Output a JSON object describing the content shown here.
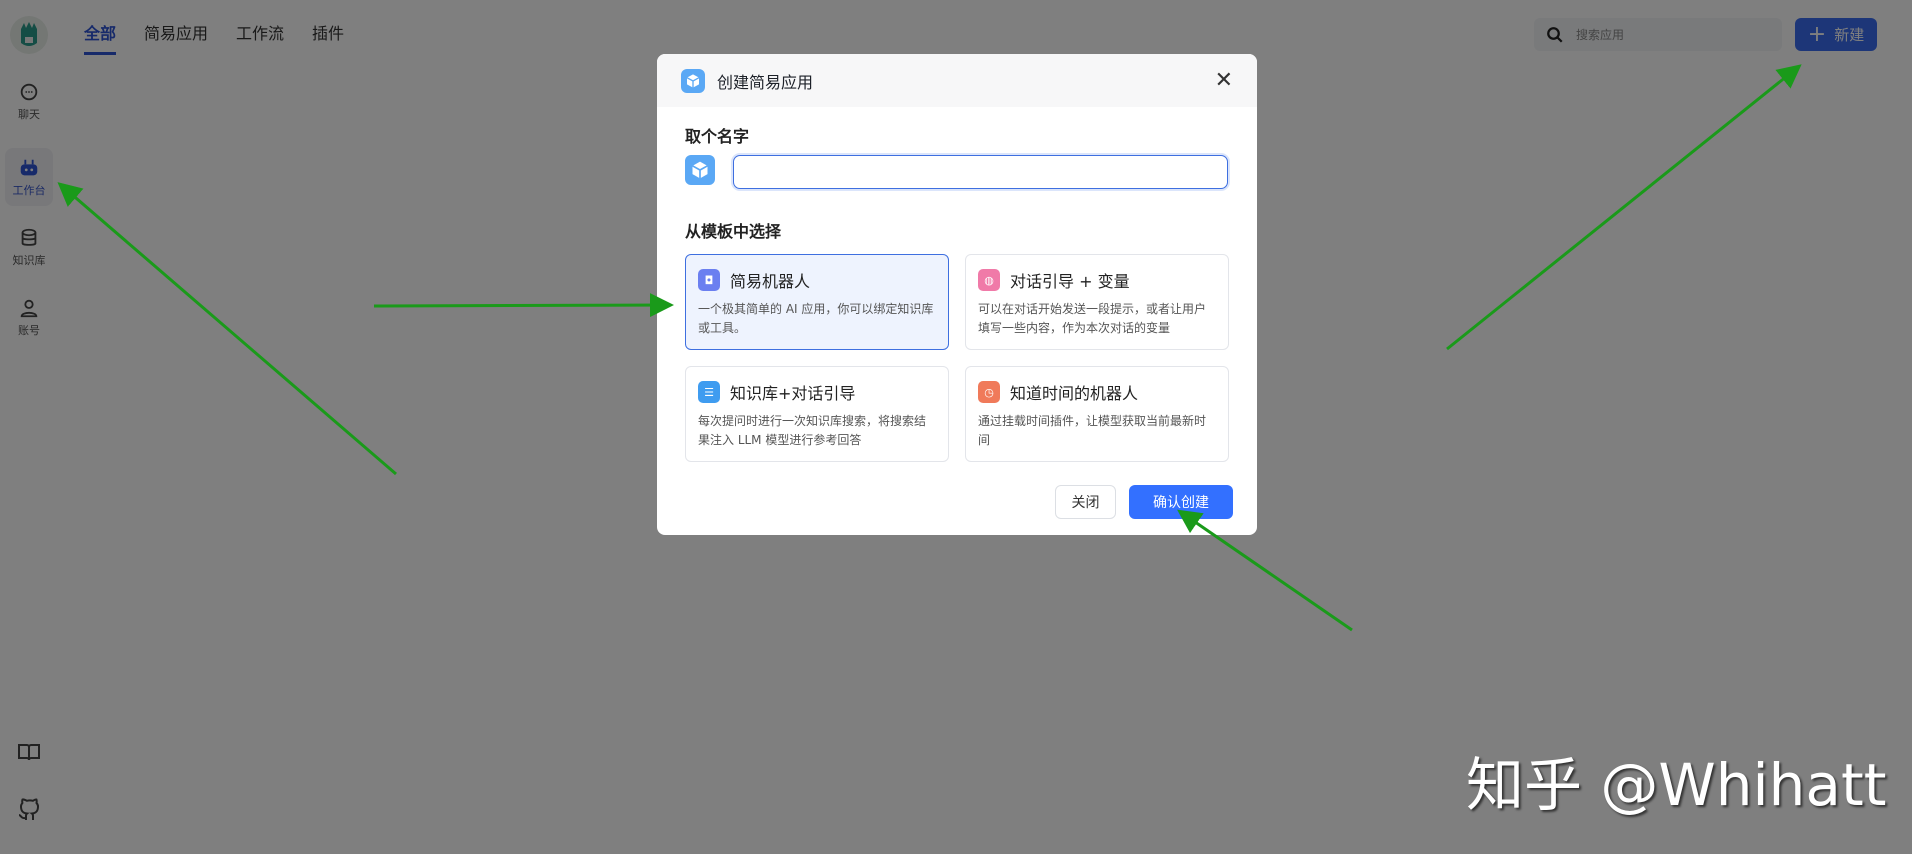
{
  "tabs": [
    {
      "label": "全部",
      "active": true
    },
    {
      "label": "简易应用"
    },
    {
      "label": "工作流"
    },
    {
      "label": "插件"
    }
  ],
  "sidebar": {
    "items": [
      {
        "label": "聊天",
        "icon": "chat-icon"
      },
      {
        "label": "工作台",
        "icon": "robot-icon",
        "active": true
      },
      {
        "label": "知识库",
        "icon": "database-icon"
      },
      {
        "label": "账号",
        "icon": "user-icon"
      }
    ],
    "bottom": [
      "book-icon",
      "github-icon"
    ]
  },
  "search": {
    "placeholder": "搜索应用"
  },
  "new_button": "新建",
  "dialog": {
    "title": "创建简易应用",
    "name_label": "取个名字",
    "name_value": "",
    "template_label": "从模板中选择",
    "templates": [
      {
        "title": "简易机器人",
        "desc": "一个极其简单的 AI 应用，你可以绑定知识库或工具。",
        "color": "#6b7ff0",
        "selected": true
      },
      {
        "title": "对话引导 + 变量",
        "desc": "可以在对话开始发送一段提示，或者让用户填写一些内容，作为本次对话的变量",
        "color": "#f07aa8"
      },
      {
        "title": "知识库+对话引导",
        "desc": "每次提问时进行一次知识库搜索，将搜索结果注入 LLM 模型进行参考回答",
        "color": "#3f9cf0"
      },
      {
        "title": "知道时间的机器人",
        "desc": "通过挂载时间插件，让模型获取当前最新时间",
        "color": "#f07a5a"
      }
    ],
    "cancel": "关闭",
    "confirm": "确认创建"
  },
  "watermark": "知乎 @Whihatt",
  "colors": {
    "accent": "#3370ff",
    "arrow": "#1a9a1a"
  }
}
